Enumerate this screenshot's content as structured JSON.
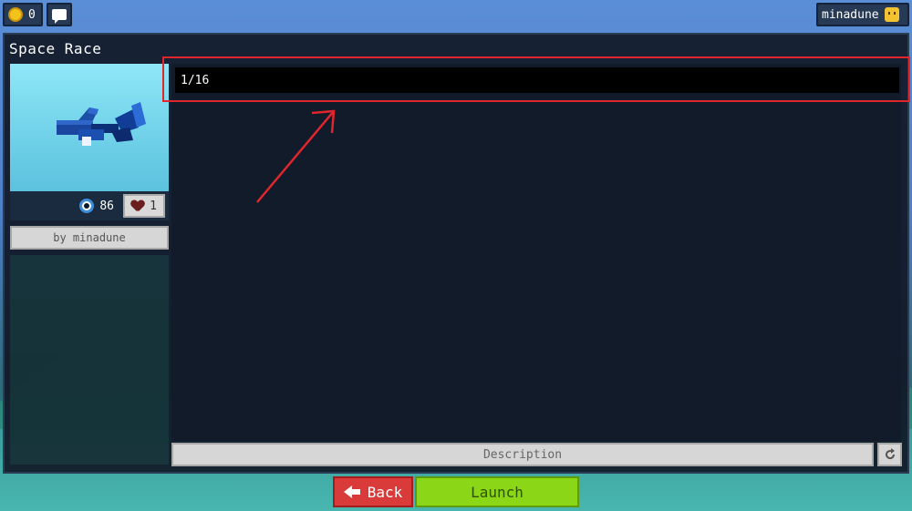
{
  "topbar": {
    "coins": "0",
    "username": "minadune",
    "icons": {
      "coin": "coin-icon",
      "chat": "chat-icon",
      "avatar": "avatar-face-icon"
    }
  },
  "map": {
    "title": "Space Race",
    "views": "86",
    "likes": "1",
    "author_label": "by minadune"
  },
  "players_field": {
    "value": "1/16"
  },
  "description_label": "Description",
  "buttons": {
    "back": "Back",
    "launch": "Launch"
  },
  "colors": {
    "panel_bg": "#101826",
    "highlight": "#e0262c",
    "back": "#d93a3a",
    "launch": "#8bd617",
    "coin": "#f4c21b"
  }
}
